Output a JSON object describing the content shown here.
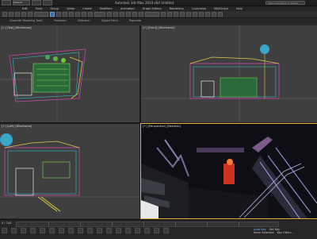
{
  "window": {
    "title": "Autodesk 3ds Max 2014 x64     Untitled",
    "workspace": "Default",
    "search_placeholder": "Type a keyword or phrase"
  },
  "menu": [
    "Edit",
    "Tools",
    "Group",
    "Views",
    "Create",
    "Modifiers",
    "Animation",
    "Graph Editors",
    "Rendering",
    "Customize",
    "MAXScript",
    "Help"
  ],
  "ribbon": [
    "Graphite Modeling Tools",
    "Freeform",
    "Selection",
    "Object Paint",
    "Populate"
  ],
  "viewports": {
    "top": "[+] [Top] [Wireframe]",
    "front": "[+] [Front] [Wireframe]",
    "left": "[+] [Left] [Wireframe]",
    "perspective": "[+] [Perspective] [Realistic]"
  },
  "statusbar": {
    "selection": "None Selected",
    "auto_key": "Auto Key",
    "set_key": "Set Key",
    "key_filters": "Key Filters...",
    "frame": "0 / 100"
  },
  "colors": {
    "active_border": "#e8b33c",
    "accent": "#3b6ea8",
    "marker": "#39a6c9"
  }
}
